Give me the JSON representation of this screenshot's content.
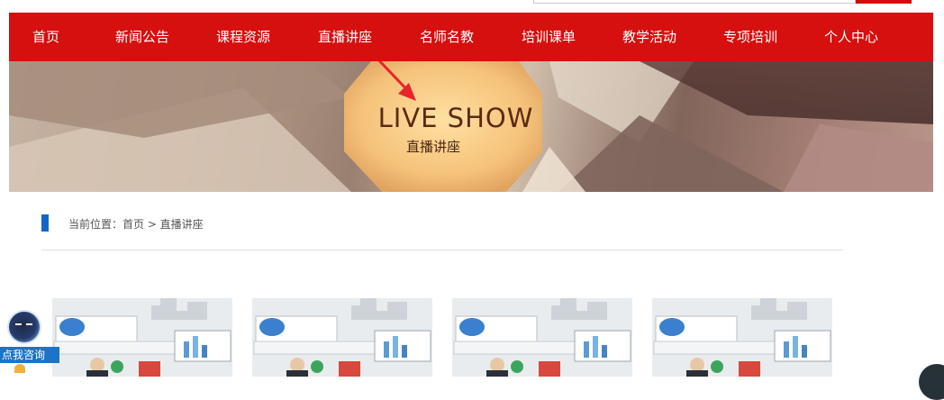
{
  "nav": {
    "items": [
      {
        "label": "首页"
      },
      {
        "label": "新闻公告"
      },
      {
        "label": "课程资源"
      },
      {
        "label": "直播讲座"
      },
      {
        "label": "名师名教"
      },
      {
        "label": "培训课单"
      },
      {
        "label": "教学活动"
      },
      {
        "label": "专项培训"
      },
      {
        "label": "个人中心"
      }
    ]
  },
  "banner": {
    "title": "LIVE SHOW",
    "subtitle": "直播讲座"
  },
  "breadcrumb": {
    "text": "当前位置：首页 > 直播讲座"
  },
  "consult": {
    "label": "点我咨询"
  },
  "colors": {
    "nav_bg": "#d60f0f",
    "accent_blue": "#1565c9",
    "arrow": "#e8242a"
  },
  "icons": [
    "search-icon",
    "arrow-annotation-icon",
    "consult-avatar-icon"
  ]
}
